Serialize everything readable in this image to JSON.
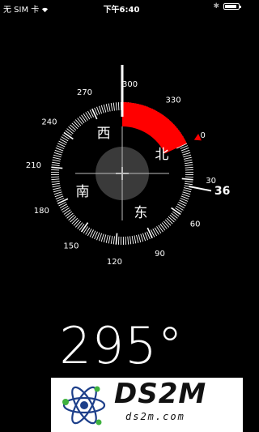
{
  "status_bar": {
    "carrier": "无 SIM 卡",
    "time": "下午6:40",
    "bluetooth": "✱",
    "battery_fraction": 0.85
  },
  "compass": {
    "heading_value": 295,
    "heading_display": "295°",
    "target_display": "36",
    "target_bearing": 36,
    "degree_labels": [
      "0",
      "30",
      "60",
      "90",
      "120",
      "150",
      "180",
      "210",
      "240",
      "270",
      "300",
      "330"
    ],
    "cardinals": {
      "north": "北",
      "east": "东",
      "south": "南",
      "west": "西"
    },
    "colors": {
      "arc": "#ff0000",
      "north_marker": "#ff0000",
      "ticks": "#ffffff",
      "center_disc": "#3a3a3a"
    }
  },
  "watermark": {
    "title": "DS2M",
    "subtitle": "ds2m.com"
  }
}
